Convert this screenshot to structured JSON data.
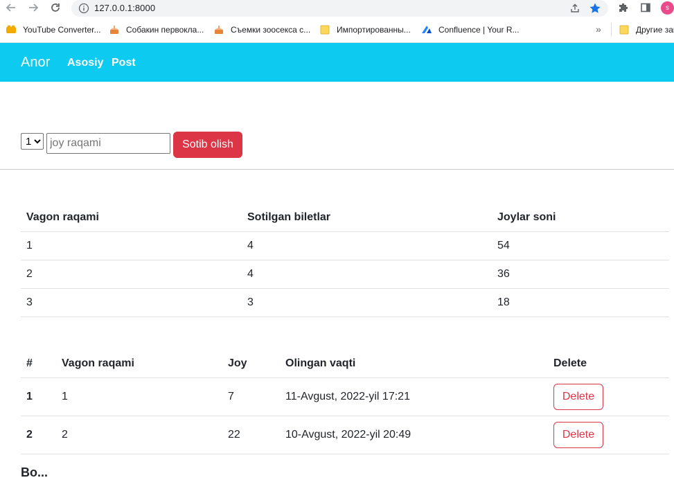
{
  "browser": {
    "url": "127.0.0.1:8000",
    "bookmarks": [
      {
        "label": "YouTube Converter...",
        "icon": "converter-icon"
      },
      {
        "label": "Собакин первокла...",
        "icon": "cake-icon"
      },
      {
        "label": "Съемки зоосекса с...",
        "icon": "cake-icon"
      },
      {
        "label": "Импортированны...",
        "icon": "folder-icon"
      },
      {
        "label": "Confluence | Your R...",
        "icon": "confluence-icon"
      }
    ],
    "more_label": "»",
    "other_bookmarks": "Другие зак",
    "profile_initial": "s"
  },
  "navbar": {
    "brand": "Anor",
    "links": [
      "Asosiy",
      "Post"
    ],
    "bg_color": "#0dcaf0"
  },
  "form": {
    "select_value": "1",
    "input_placeholder": "joy raqami",
    "button_label": "Sotib olish",
    "button_color": "#dc3545"
  },
  "wagons_table": {
    "headers": [
      "Vagon raqami",
      "Sotilgan biletlar",
      "Joylar soni"
    ],
    "rows": [
      [
        "1",
        "4",
        "54"
      ],
      [
        "2",
        "4",
        "36"
      ],
      [
        "3",
        "3",
        "18"
      ]
    ]
  },
  "tickets_table": {
    "headers": [
      "#",
      "Vagon raqami",
      "Joy",
      "Olingan vaqti",
      "Delete"
    ],
    "rows": [
      {
        "num": "1",
        "vagon": "1",
        "joy": "7",
        "time": "11-Avgust, 2022-yil 17:21",
        "action": "Delete"
      },
      {
        "num": "2",
        "vagon": "2",
        "joy": "22",
        "time": "10-Avgust, 2022-yil 20:49",
        "action": "Delete"
      }
    ]
  },
  "footer_heading_partial": "Bo..."
}
